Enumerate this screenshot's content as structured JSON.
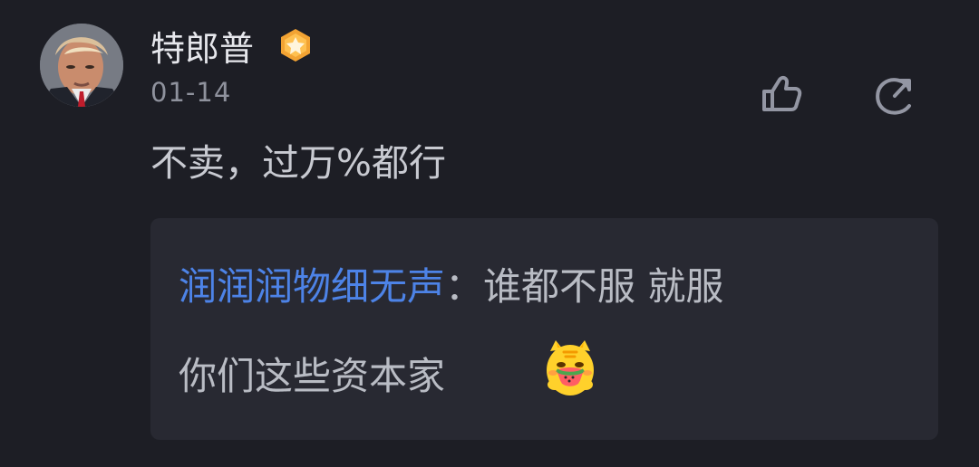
{
  "comment": {
    "username": "特郎普",
    "date": "01-14",
    "text": "不卖，过万%都行"
  },
  "quote": {
    "author": "润润润物细无声",
    "separator": "：",
    "line1": "谁都不服 就服",
    "line2": "你们这些资本家"
  },
  "icons": {
    "verified": "verified-badge-icon",
    "like": "thumbs-up-icon",
    "reply": "reply-icon",
    "sticker": "tiger-eating-watermelon-sticker"
  },
  "colors": {
    "background": "#1d1e25",
    "quote_background": "#282932",
    "username": "#e6e7ec",
    "date": "#8f929d",
    "text": "#c8cad1",
    "quote_author": "#4d83e7",
    "icon": "#9396a3",
    "badge": "#f2a333"
  }
}
